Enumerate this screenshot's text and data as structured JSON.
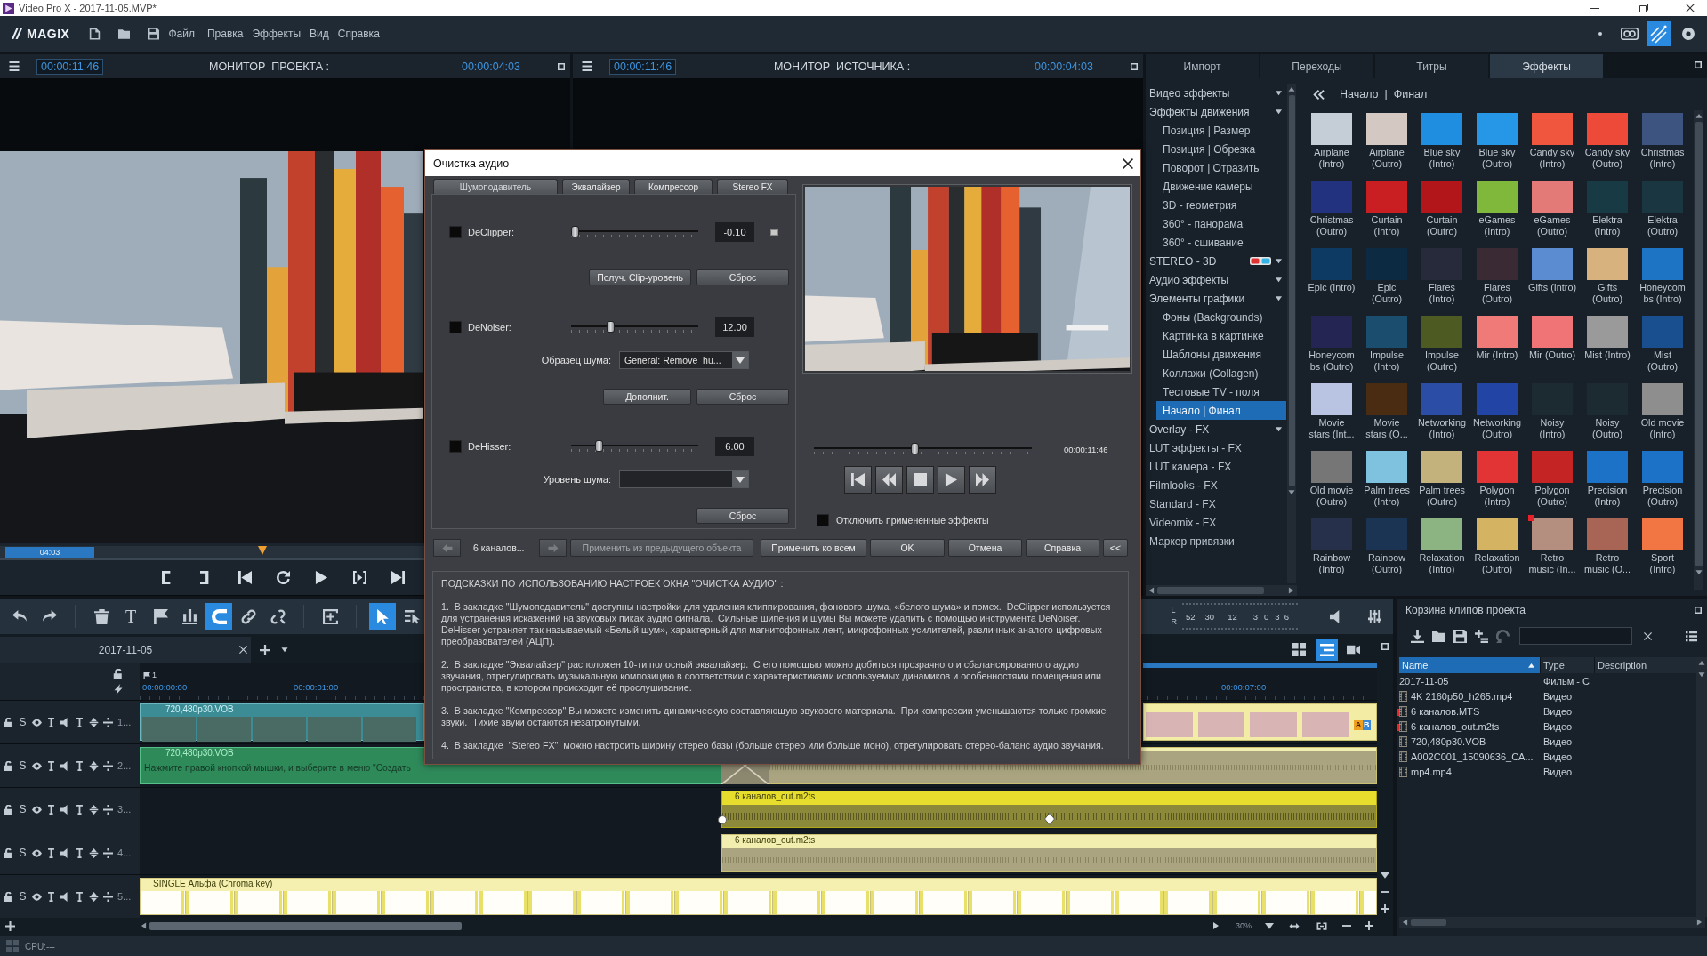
{
  "window": {
    "title": "Video Pro X - 2017-11-05.MVP*"
  },
  "menu_bar": {
    "logo": "MAGIX",
    "items": [
      "Файл",
      "Правка",
      "Эффекты",
      "Вид",
      "Справка"
    ]
  },
  "monitors": [
    {
      "timecode": "00:00:11:46",
      "title": "МОНИТОР  ПРОЕКТА :",
      "duration": "00:00:04:03",
      "range_label": "04:03",
      "level": 0.46
    },
    {
      "timecode": "00:00:11:46",
      "title": "МОНИТОР  ИСТОЧНИКА :",
      "duration": "00:00:04:03"
    }
  ],
  "effects_panel": {
    "tabs": [
      {
        "label": "Импорт",
        "selected": false
      },
      {
        "label": "Переходы",
        "selected": false
      },
      {
        "label": "Титры",
        "selected": false
      },
      {
        "label": "Эффекты",
        "selected": true
      }
    ],
    "categories": [
      {
        "label": "Видео эффекты",
        "kind": "group",
        "selected": false
      },
      {
        "label": "Эффекты движения",
        "kind": "group",
        "selected": false,
        "children": [
          {
            "label": "Позиция | Размер",
            "kind": "item",
            "selected": false
          },
          {
            "label": "Позиция | Обрезка",
            "kind": "item",
            "selected": false
          },
          {
            "label": "Поворот | Отразить",
            "kind": "item",
            "selected": false
          },
          {
            "label": "Движение камеры",
            "kind": "item",
            "selected": false
          },
          {
            "label": "3D - геометрия",
            "kind": "item",
            "selected": false
          },
          {
            "label": "360° - панорама",
            "kind": "item",
            "selected": false
          },
          {
            "label": "360° - сшивание",
            "kind": "item",
            "selected": false
          }
        ]
      },
      {
        "label": "STEREO - 3D",
        "kind": "stereo",
        "selected": false
      },
      {
        "label": "Аудио эффекты",
        "kind": "group",
        "selected": false
      },
      {
        "label": "Элементы графики",
        "kind": "group",
        "selected": false,
        "children": [
          {
            "label": "Фоны (Backgrounds)",
            "kind": "item",
            "selected": false
          },
          {
            "label": "Картинка в картинке",
            "kind": "item",
            "selected": false
          },
          {
            "label": "Шаблоны движения",
            "kind": "item",
            "selected": false
          },
          {
            "label": "Коллажи (Collagen)",
            "kind": "item",
            "selected": false
          },
          {
            "label": "Тестовые TV - поля",
            "kind": "item",
            "selected": false
          },
          {
            "label": "Начало | Финал",
            "kind": "item",
            "selected": true
          }
        ]
      },
      {
        "label": "Overlay - FX",
        "kind": "group",
        "selected": false
      },
      {
        "label": "LUT эффекты - FX",
        "kind": "item",
        "selected": false
      },
      {
        "label": "LUT камера - FX",
        "kind": "item",
        "selected": false
      },
      {
        "label": "Filmlooks - FX",
        "kind": "item",
        "selected": false
      },
      {
        "label": "Standard - FX",
        "kind": "item",
        "selected": false
      },
      {
        "label": "Videomix - FX",
        "kind": "item",
        "selected": false
      },
      {
        "label": "Маркер привязки",
        "kind": "item",
        "selected": false
      }
    ],
    "breadcrumb": "Начало  |  Финал",
    "effects": [
      {
        "name": "Airplane (Intro)",
        "color": "#c5ced6",
        "marked": false
      },
      {
        "name": "Airplane (Outro)",
        "color": "#d4c8c2",
        "marked": false
      },
      {
        "name": "Blue sky (Intro)",
        "color": "#1f8ee0",
        "marked": false
      },
      {
        "name": "Blue sky (Outro)",
        "color": "#2597e6",
        "marked": false
      },
      {
        "name": "Candy sky (Intro)",
        "color": "#f0553e",
        "marked": false
      },
      {
        "name": "Candy sky (Outro)",
        "color": "#ee4a3a",
        "marked": false
      },
      {
        "name": "Christmas (Intro)",
        "color": "#3d5480",
        "marked": false
      },
      {
        "name": "Christmas (Outro)",
        "color": "#23327e",
        "marked": false
      },
      {
        "name": "Curtain (Intro)",
        "color": "#c91f22",
        "marked": false
      },
      {
        "name": "Curtain (Outro)",
        "color": "#b3161a",
        "marked": false
      },
      {
        "name": "eGames (Intro)",
        "color": "#7fb83a",
        "marked": false
      },
      {
        "name": "eGames (Outro)",
        "color": "#e47a78",
        "marked": false
      },
      {
        "name": "Elektra (Intro)",
        "color": "#183a44",
        "marked": false
      },
      {
        "name": "Elektra (Outro)",
        "color": "#1a3640",
        "marked": false
      },
      {
        "name": "Epic (Intro)",
        "color": "#0d3a62",
        "marked": false
      },
      {
        "name": "Epic (Outro)",
        "color": "#0c2a42",
        "marked": false
      },
      {
        "name": "Flares (Intro)",
        "color": "#262a3a",
        "marked": false
      },
      {
        "name": "Flares (Outro)",
        "color": "#3a2a34",
        "marked": false
      },
      {
        "name": "Gifts (Intro)",
        "color": "#5b8cd2",
        "marked": false
      },
      {
        "name": "Gifts (Outro)",
        "color": "#d8b27e",
        "marked": false
      },
      {
        "name": "Honeycombs (Intro)",
        "color": "#1d74c4",
        "marked": false
      },
      {
        "name": "Honeycombs (Outro)",
        "color": "#242552",
        "marked": false
      },
      {
        "name": "Impulse (Intro)",
        "color": "#1b4d6e",
        "marked": false
      },
      {
        "name": "Impulse (Outro)",
        "color": "#4d5a22",
        "marked": false
      },
      {
        "name": "Mir (Intro)",
        "color": "#f07a78",
        "marked": false
      },
      {
        "name": "Mir (Outro)",
        "color": "#f07476",
        "marked": false
      },
      {
        "name": "Mist (Intro)",
        "color": "#9a9a9a",
        "marked": false
      },
      {
        "name": "Mist (Outro)",
        "color": "#1a4f8f",
        "marked": false
      },
      {
        "name": "Movie stars (Int...",
        "color": "#b9c4e2",
        "marked": false
      },
      {
        "name": "Movie stars (O...",
        "color": "#4a2c12",
        "marked": false
      },
      {
        "name": "Networking (Intro)",
        "color": "#2b4da6",
        "marked": false
      },
      {
        "name": "Networking (Outro)",
        "color": "#2244a4",
        "marked": false
      },
      {
        "name": "Noisy (Intro)",
        "color": "#1c2a32",
        "marked": false
      },
      {
        "name": "Noisy (Outro)",
        "color": "#1c2a32",
        "marked": false
      },
      {
        "name": "Old movie (Intro)",
        "color": "#8e8e8e",
        "marked": false
      },
      {
        "name": "Old movie (Outro)",
        "color": "#767676",
        "marked": false
      },
      {
        "name": "Palm trees (Intro)",
        "color": "#7fc2e0",
        "marked": false
      },
      {
        "name": "Palm trees (Outro)",
        "color": "#c4b27c",
        "marked": false
      },
      {
        "name": "Polygon (Intro)",
        "color": "#e23434",
        "marked": false
      },
      {
        "name": "Polygon (Outro)",
        "color": "#c42424",
        "marked": false
      },
      {
        "name": "Precision (Intro)",
        "color": "#1b72c6",
        "marked": false
      },
      {
        "name": "Precision (Outro)",
        "color": "#1b72c6",
        "marked": false
      },
      {
        "name": "Rainbow (Intro)",
        "color": "#27304a",
        "marked": false
      },
      {
        "name": "Rainbow (Outro)",
        "color": "#1c3454",
        "marked": false
      },
      {
        "name": "Relaxation (Intro)",
        "color": "#8cb482",
        "marked": false
      },
      {
        "name": "Relaxation (Outro)",
        "color": "#d4b462",
        "marked": false
      },
      {
        "name": "Retro music (In...",
        "color": "#b48e7e",
        "marked": true
      },
      {
        "name": "Retro music (O...",
        "color": "#a86454",
        "marked": false
      },
      {
        "name": "Sport (Intro)",
        "color": "#f27644",
        "marked": false
      }
    ]
  },
  "dialog": {
    "title": "Очистка аудио",
    "tabs": [
      {
        "label": "Шумоподавитель",
        "selected": true
      },
      {
        "label": "Эквалайзер",
        "selected": false
      },
      {
        "label": "Компрессор",
        "selected": false
      },
      {
        "label": "Stereo FX",
        "selected": false
      }
    ],
    "filters": [
      {
        "name": "DeClipper:",
        "checked": false,
        "level": 0.0,
        "value": "-0.10",
        "led": true,
        "buttons": [
          "Получ. Clip-уровень",
          "Сброс"
        ]
      },
      {
        "name": "DeNoiser:",
        "checked": false,
        "level": 0.3,
        "value": "12.00",
        "led": false,
        "select": {
          "label": "Образец шума:",
          "value": "General: Remove  hu..."
        },
        "buttons": [
          "Дополнит.",
          "Сброс"
        ]
      },
      {
        "name": "DeHisser:",
        "checked": false,
        "level": 0.2,
        "value": "6.00",
        "led": false,
        "select": {
          "label": "Уровень шума:"
        },
        "buttons": [
          "Сброс"
        ]
      }
    ],
    "preview": {
      "level": 0.46,
      "time": "00:00:11:46"
    },
    "bypass": {
      "label": "Отключить примененные эффекты",
      "checked": false
    },
    "footer": {
      "prev": {
        "disabled": true
      },
      "object": "6 каналов...",
      "next": {
        "disabled": true
      },
      "buttons": [
        {
          "label": "Применить из предыдущего объекта",
          "disabled": true
        },
        {
          "label": "Применить ко всем",
          "disabled": false
        },
        {
          "label": "OK",
          "disabled": false
        },
        {
          "label": "Отмена",
          "disabled": false
        },
        {
          "label": "Справка",
          "disabled": false
        },
        {
          "label": "<<",
          "disabled": false
        }
      ]
    },
    "hints": {
      "title": "ПОДСКАЗКИ ПО ИСПОЛЬЗОВАНИЮ НАСТРОЕК ОКНА \"ОЧИСТКА АУДИО\" :",
      "paragraphs": [
        "1.  В закладке \"Шумоподавитель\" доступны настройки для удаления клиппирования, фонового шума, «белого шума» и помех.  DeClipper используется для устранения искажений на звуковых пиках аудио сигнала.  Сильные шипения и шумы Вы можете удалить с помощью инструмента DeNoiser.  DeHisser устраняет так называемый «Белый шум», характерный для магнитофонных лент, микрофонных усилителей, различных аналого-цифровых преобразователей (АЦП).",
        "2.  В закладке \"Эквалайзер\" расположен 10-ти полосный эквалайзер.  С его помощью можно добиться прозрачного и сбалансированного аудио звучания, отрегулировать музыкальную композицию в соответствии с характеристиками используемых динамиков и особенностями помещения или пространства, в котором происходит её прослушивание.",
        "3.  В закладке \"Компрессор\" Вы можете изменить динамическую составляющую звукового материала.  При компрессии уменьшаются только громкие звуки.  Тихие звуки остаются незатронутыми.",
        "4.  В закладке  \"Stereo FX\"  можно настроить ширину стерео базы (больше стерео или больше моно), отрегулировать стерео-баланс аудио звучания."
      ]
    }
  },
  "timeline": {
    "toolbar": [
      [
        {
          "kind": "undo",
          "on": false
        },
        {
          "kind": "redo",
          "on": false
        }
      ],
      [
        {
          "kind": "delete",
          "on": false
        },
        {
          "kind": "text",
          "label": "T",
          "on": false
        },
        {
          "kind": "marker",
          "on": false
        },
        {
          "kind": "split",
          "on": false
        },
        {
          "kind": "snap",
          "on": true
        },
        {
          "kind": "link",
          "on": false
        },
        {
          "kind": "unlink",
          "on": false
        }
      ],
      [
        {
          "kind": "insert",
          "on": false
        }
      ],
      [
        {
          "kind": "pointer",
          "on": true
        },
        {
          "kind": "range",
          "on": false
        }
      ]
    ],
    "meter": {
      "channels": [
        "L",
        "R"
      ],
      "scale": [
        "52",
        "30",
        "12",
        "3",
        "0",
        "3",
        "6"
      ]
    },
    "tab": "2017-11-05",
    "ruler": {
      "marker": "1",
      "timecodes": [
        "00:00:00:00",
        "00:00:01:00",
        "00:00:07:00"
      ]
    },
    "tracks": [
      {
        "solo": "S",
        "number": "1...",
        "clips": [
          {
            "kind": "video",
            "title": "720,480p30.VOB"
          },
          {
            "kind": "slideshow",
            "labels": [
              "A",
              "B"
            ]
          }
        ]
      },
      {
        "solo": "S",
        "number": "2...",
        "clips": [
          {
            "kind": "video-text",
            "title": "720,480p30.VOB",
            "text": "Нажмите правой кнопкой мышки, и выберите в меню \"Создать"
          },
          {
            "kind": "transition"
          },
          {
            "kind": "audio",
            "selected": false,
            "handles": false
          }
        ]
      },
      {
        "solo": "S",
        "number": "3...",
        "clips": [
          {
            "kind": "audio",
            "title": "6 каналов_out.m2ts",
            "selected": true,
            "handles": true
          }
        ]
      },
      {
        "solo": "S",
        "number": "4...",
        "clips": [
          {
            "kind": "audio",
            "title": "6 каналов_out.m2ts",
            "selected": false,
            "handles": false
          }
        ]
      },
      {
        "solo": "S",
        "number": "5...",
        "clips": [
          {
            "kind": "title",
            "title": "SINGLE Альфа (Chroma key)"
          }
        ]
      }
    ],
    "zoom": "30%"
  },
  "clip_bin": {
    "title": "Корзина клипов проекта",
    "columns": [
      {
        "label": "Name",
        "sorted": true
      },
      {
        "label": "Type",
        "sorted": false
      },
      {
        "label": "Description",
        "sorted": false
      }
    ],
    "rows": [
      {
        "kind": "movie",
        "name": "2017-11-05",
        "type": "Фильм - С",
        "flagged": false
      },
      {
        "kind": "file",
        "name": "4K 2160p50_h265.mp4",
        "type": "Видео",
        "flagged": false
      },
      {
        "kind": "file",
        "name": "6 каналов.MTS",
        "type": "Видео",
        "flagged": true
      },
      {
        "kind": "file",
        "name": "6 каналов_out.m2ts",
        "type": "Видео",
        "flagged": true
      },
      {
        "kind": "file",
        "name": "720,480p30.VOB",
        "type": "Видео",
        "flagged": false
      },
      {
        "kind": "file",
        "name": "A002C001_15090636_CA...",
        "type": "Видео",
        "flagged": false
      },
      {
        "kind": "file",
        "name": "mp4.mp4",
        "type": "Видео",
        "flagged": false
      }
    ]
  },
  "status_bar": {
    "cpu": "CPU:---"
  }
}
